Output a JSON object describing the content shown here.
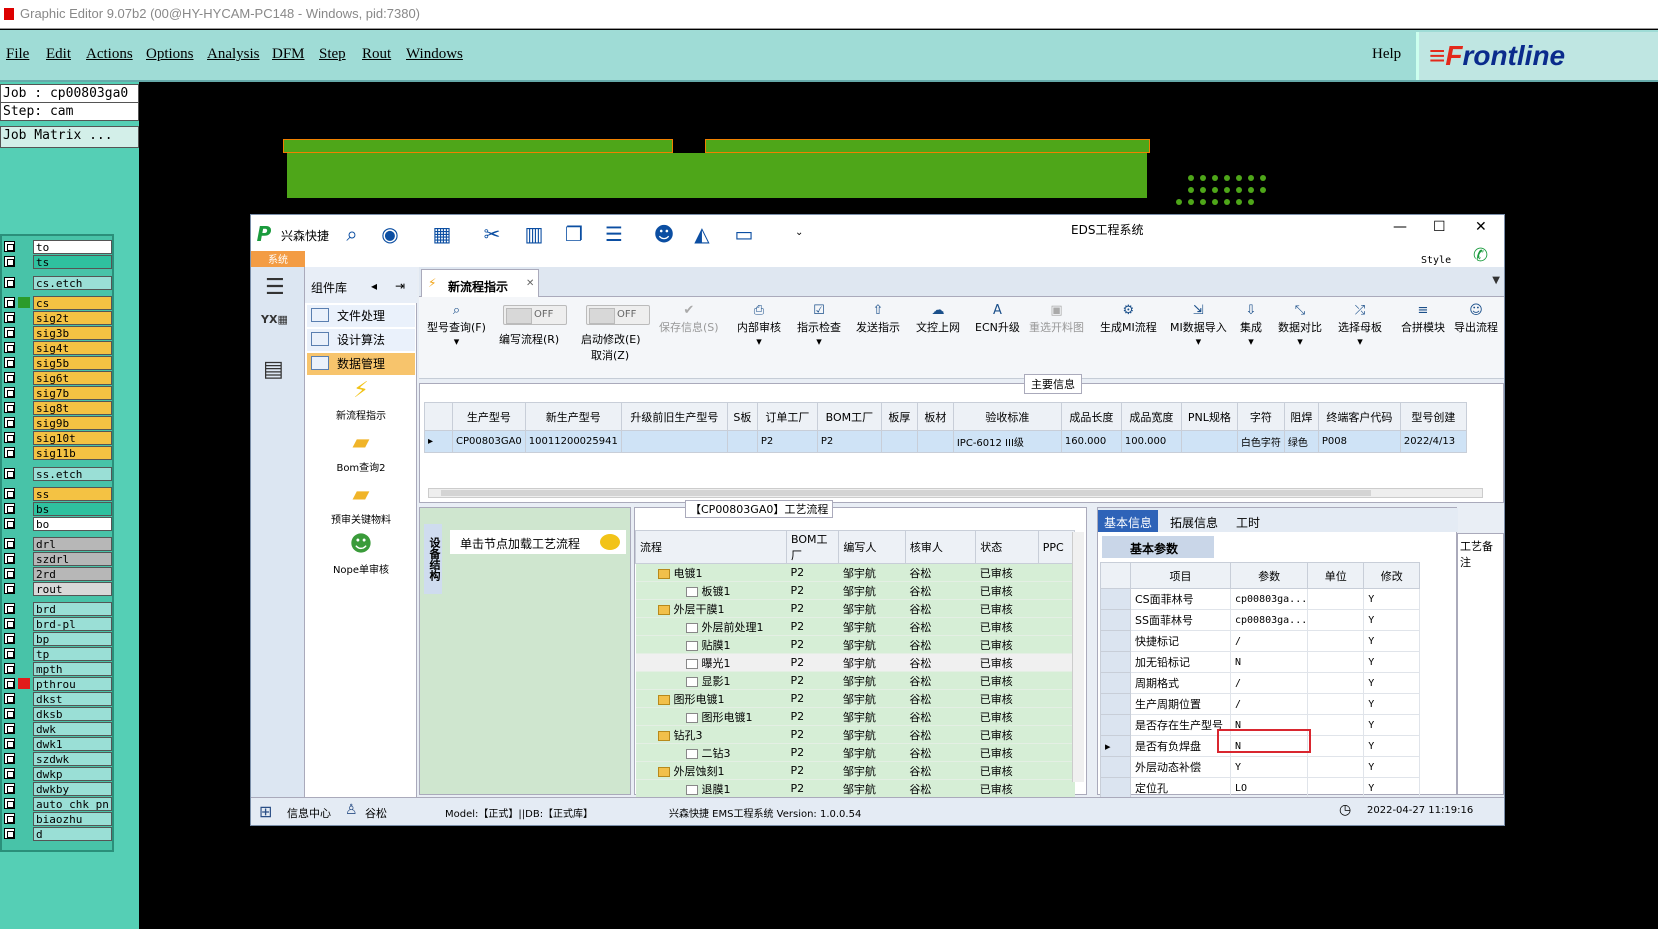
{
  "graphic_editor": {
    "window_title": "Graphic Editor 9.07b2 (00@HY-HYCAM-PC148 - Windows, pid:7380)",
    "menu": [
      "File",
      "Edit",
      "Actions",
      "Options",
      "Analysis",
      "DFM",
      "Step",
      "Rout",
      "Windows"
    ],
    "help": "Help",
    "logo_text_a": "≡F",
    "logo_text_b": "rontline",
    "job_line": "Job : cp00803ga0",
    "step_line": "Step: cam",
    "matrix_label": "Job Matrix ...",
    "layers": [
      {
        "name": "to",
        "color": "#ffffff"
      },
      {
        "name": "ts",
        "color": "#2fc19f"
      },
      {
        "name": "cs.etch",
        "color": "#9adfd6"
      },
      {
        "name": "cs",
        "color": "#f4c243"
      },
      {
        "name": "sig2t",
        "color": "#f4c243"
      },
      {
        "name": "sig3b",
        "color": "#f4c243"
      },
      {
        "name": "sig4t",
        "color": "#f4c243"
      },
      {
        "name": "sig5b",
        "color": "#f4c243"
      },
      {
        "name": "sig6t",
        "color": "#f4c243"
      },
      {
        "name": "sig7b",
        "color": "#f4c243"
      },
      {
        "name": "sig8t",
        "color": "#f4c243"
      },
      {
        "name": "sig9b",
        "color": "#f4c243"
      },
      {
        "name": "sig10t",
        "color": "#f4c243"
      },
      {
        "name": "sig11b",
        "color": "#f4c243"
      },
      {
        "name": "ss.etch",
        "color": "#9adfd6"
      },
      {
        "name": "ss",
        "color": "#f4c243"
      },
      {
        "name": "bs",
        "color": "#2fc19f"
      },
      {
        "name": "bo",
        "color": "#ffffff"
      },
      {
        "name": "drl",
        "color": "#b7b7b7"
      },
      {
        "name": "szdrl",
        "color": "#b7b7b7"
      },
      {
        "name": "2rd",
        "color": "#b7b7b7"
      },
      {
        "name": "rout",
        "color": "#d8d8d8"
      },
      {
        "name": "brd",
        "color": "#9adfd6"
      },
      {
        "name": "brd-pl",
        "color": "#9adfd6"
      },
      {
        "name": "bp",
        "color": "#9adfd6"
      },
      {
        "name": "tp",
        "color": "#9adfd6"
      },
      {
        "name": "mpth",
        "color": "#9adfd6"
      },
      {
        "name": "pthrou",
        "color": "#9adfd6"
      },
      {
        "name": "dkst",
        "color": "#9adfd6"
      },
      {
        "name": "dksb",
        "color": "#9adfd6"
      },
      {
        "name": "dwk",
        "color": "#9adfd6"
      },
      {
        "name": "dwk1",
        "color": "#9adfd6"
      },
      {
        "name": "szdwk",
        "color": "#9adfd6"
      },
      {
        "name": "dwkp",
        "color": "#9adfd6"
      },
      {
        "name": "dwkby",
        "color": "#9adfd6"
      },
      {
        "name": "auto_chk_pn",
        "color": "#9adfd6"
      },
      {
        "name": "biaozhu",
        "color": "#9adfd6"
      },
      {
        "name": "d",
        "color": "#9adfd6"
      }
    ]
  },
  "eds": {
    "title": "EDS工程系统",
    "brand": "兴森快捷",
    "style_label": "Style",
    "system_tab": "系统",
    "component_lib": "组件库",
    "lib_items": [
      "文件处理",
      "设计算法",
      "数据管理"
    ],
    "lib_tools": [
      "新流程指示",
      "Bom查询2",
      "预审关键物料",
      "Nope单审核"
    ],
    "open_tab": "新流程指示",
    "ribbon": [
      {
        "label": "型号查询(F)",
        "icon": "search-icon",
        "enabled": true
      },
      {
        "label": "编写流程(R)",
        "icon": "toggle-icon",
        "enabled": true
      },
      {
        "label": "启动修改(E)",
        "icon": "toggle-icon",
        "enabled": true
      },
      {
        "label": "保存信息(S)",
        "icon": "check-icon",
        "enabled": false
      },
      {
        "label": "内部审核",
        "icon": "print-icon",
        "enabled": true
      },
      {
        "label": "指示检查",
        "icon": "check-icon",
        "enabled": true
      },
      {
        "label": "发送指示",
        "icon": "upload-icon",
        "enabled": true
      },
      {
        "label": "文控上网",
        "icon": "cloud-upload-icon",
        "enabled": true
      },
      {
        "label": "ECN升级",
        "icon": "ecn-icon",
        "enabled": true
      },
      {
        "label": "重选开料图",
        "icon": "image-icon",
        "enabled": false
      },
      {
        "label": "生成MI流程",
        "icon": "gears-icon",
        "enabled": true
      },
      {
        "label": "MI数据导入",
        "icon": "import-icon",
        "enabled": true
      },
      {
        "label": "集成",
        "icon": "download-icon",
        "enabled": true
      },
      {
        "label": "数据对比",
        "icon": "compare-icon",
        "enabled": true
      },
      {
        "label": "选择母板",
        "icon": "shuffle-icon",
        "enabled": true
      },
      {
        "label": "合拼模块",
        "icon": "list-icon",
        "enabled": true
      },
      {
        "label": "导出流程",
        "icon": "export-icon",
        "enabled": true
      }
    ],
    "toggle_off": "OFF",
    "cancel_label": "取消(Z)",
    "main_info_label": "主要信息",
    "main_columns": [
      "生产型号",
      "新生产型号",
      "升级前旧生产型号",
      "S板",
      "订单工厂",
      "BOM工厂",
      "板厚",
      "板材",
      "验收标准",
      "成品长度",
      "成品宽度",
      "PNL规格",
      "字符",
      "阻焊",
      "终端客户代码",
      "型号创建"
    ],
    "main_row": [
      "CP00803GA0",
      "10011200025941",
      "",
      "",
      "P2",
      "P2",
      "",
      "",
      "IPC-6012 III级",
      "160.000",
      "100.000",
      "",
      "白色字符",
      "绿色",
      "P008",
      "2022/4/13"
    ],
    "node_hint": "单击节点加载工艺流程",
    "side_vertical": "设备结构",
    "flow_title": "【CP00803GA0】工艺流程",
    "flow_columns": [
      "流程",
      "BOM工厂",
      "编写人",
      "核审人",
      "状态",
      "PPC"
    ],
    "flow_rows": [
      {
        "name": "电镀1",
        "folder": true,
        "indent": 1,
        "factory": "P2",
        "writer": "邹宇航",
        "reviewer": "谷松",
        "status": "已审核"
      },
      {
        "name": "板镀1",
        "folder": false,
        "indent": 2,
        "factory": "P2",
        "writer": "邹宇航",
        "reviewer": "谷松",
        "status": "已审核"
      },
      {
        "name": "外层干膜1",
        "folder": true,
        "indent": 1,
        "factory": "P2",
        "writer": "邹宇航",
        "reviewer": "谷松",
        "status": "已审核"
      },
      {
        "name": "外层前处理1",
        "folder": false,
        "indent": 2,
        "factory": "P2",
        "writer": "邹宇航",
        "reviewer": "谷松",
        "status": "已审核"
      },
      {
        "name": "贴膜1",
        "folder": false,
        "indent": 2,
        "factory": "P2",
        "writer": "邹宇航",
        "reviewer": "谷松",
        "status": "已审核"
      },
      {
        "name": "曝光1",
        "folder": false,
        "indent": 2,
        "factory": "P2",
        "writer": "邹宇航",
        "reviewer": "谷松",
        "status": "已审核"
      },
      {
        "name": "显影1",
        "folder": false,
        "indent": 2,
        "factory": "P2",
        "writer": "邹宇航",
        "reviewer": "谷松",
        "status": "已审核"
      },
      {
        "name": "图形电镀1",
        "folder": true,
        "indent": 1,
        "factory": "P2",
        "writer": "邹宇航",
        "reviewer": "谷松",
        "status": "已审核"
      },
      {
        "name": "图形电镀1",
        "folder": false,
        "indent": 2,
        "factory": "P2",
        "writer": "邹宇航",
        "reviewer": "谷松",
        "status": "已审核"
      },
      {
        "name": "钻孔3",
        "folder": true,
        "indent": 1,
        "factory": "P2",
        "writer": "邹宇航",
        "reviewer": "谷松",
        "status": "已审核"
      },
      {
        "name": "二钻3",
        "folder": false,
        "indent": 2,
        "factory": "P2",
        "writer": "邹宇航",
        "reviewer": "谷松",
        "status": "已审核"
      },
      {
        "name": "外层蚀刻1",
        "folder": true,
        "indent": 1,
        "factory": "P2",
        "writer": "邹宇航",
        "reviewer": "谷松",
        "status": "已审核"
      },
      {
        "name": "退膜1",
        "folder": false,
        "indent": 2,
        "factory": "P2",
        "writer": "邹宇航",
        "reviewer": "谷松",
        "status": "已审核"
      }
    ],
    "right_tabs": [
      "基本信息",
      "拓展信息",
      "工时"
    ],
    "basic_params": "基本参数",
    "param_columns": [
      "项目",
      "参数",
      "单位",
      "修改"
    ],
    "params": [
      {
        "item": "CS面菲林号",
        "value": "cp00803ga...",
        "unit": "",
        "mod": "Y"
      },
      {
        "item": "SS面菲林号",
        "value": "cp00803ga...",
        "unit": "",
        "mod": "Y"
      },
      {
        "item": "快捷标记",
        "value": "/",
        "unit": "",
        "mod": "Y"
      },
      {
        "item": "加无铅标记",
        "value": "N",
        "unit": "",
        "mod": "Y"
      },
      {
        "item": "周期格式",
        "value": "/",
        "unit": "",
        "mod": "Y"
      },
      {
        "item": "生产周期位置",
        "value": "/",
        "unit": "",
        "mod": "Y"
      },
      {
        "item": "是否存在生产型号",
        "value": "N",
        "unit": "",
        "mod": "Y"
      },
      {
        "item": "是否有负焊盘",
        "value": "N",
        "unit": "",
        "mod": "Y"
      },
      {
        "item": "外层动态补偿",
        "value": "Y",
        "unit": "",
        "mod": "Y"
      },
      {
        "item": "定位孔",
        "value": "LO",
        "unit": "",
        "mod": "Y"
      }
    ],
    "craft_notes": "工艺备注",
    "status": {
      "info_center": "信息中心",
      "user": "谷松",
      "model": "Model:【正式】||DB:【正式库】",
      "version": "兴森快捷 EMS工程系统 Version: 1.0.0.54",
      "datetime": "2022-04-27 11:19:16"
    }
  }
}
